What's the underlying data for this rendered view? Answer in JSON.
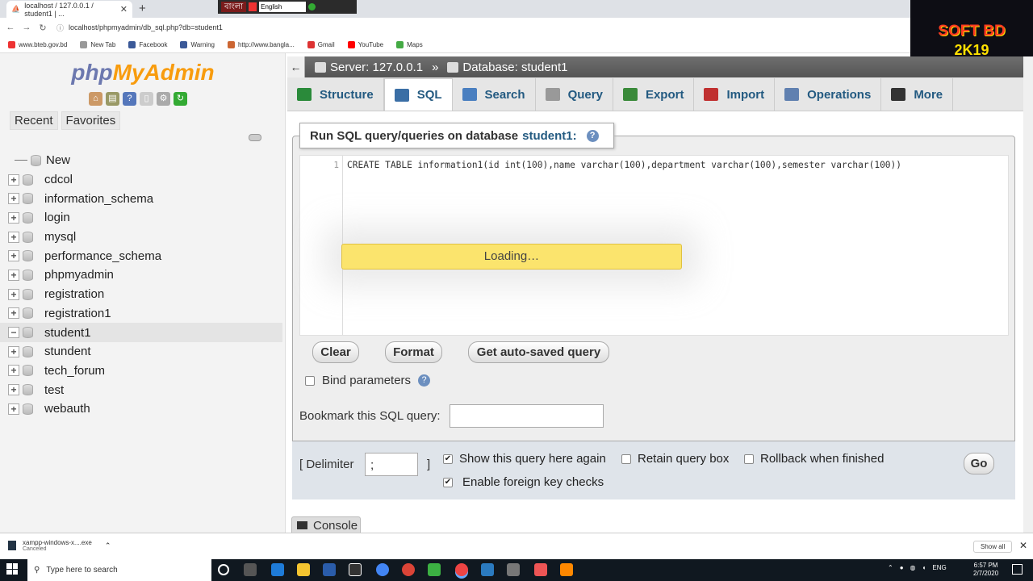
{
  "browser": {
    "tab_title": "localhost / 127.0.0.1 / student1 | ...",
    "tab_close": "✕",
    "new_tab": "+",
    "url": "localhost/phpmyadmin/db_sql.php?db=student1",
    "lang_bengali": "বাংলা",
    "lang_select": "English",
    "bookmarks": [
      "www.bteb.gov.bd",
      "New Tab",
      "Facebook",
      "Warning",
      "http://www.bangla...",
      "Gmail",
      "YouTube",
      "Maps"
    ]
  },
  "watermark": {
    "line1": "SOFT BD",
    "line2": "2K19"
  },
  "sidebar": {
    "logo_php": "php",
    "logo_admin": "MyAdmin",
    "recent": "Recent",
    "favorites": "Favorites",
    "new_label": "New",
    "databases": [
      "cdcol",
      "information_schema",
      "login",
      "mysql",
      "performance_schema",
      "phpmyadmin",
      "registration",
      "registration1",
      "student1",
      "stundent",
      "tech_forum",
      "test",
      "webauth"
    ],
    "selected_db": "student1"
  },
  "header": {
    "back": "←",
    "server": "Server: 127.0.0.1",
    "separator": "»",
    "database": "Database: student1"
  },
  "tabs": [
    {
      "label": "Structure",
      "color": "#2a8a3a"
    },
    {
      "label": "SQL",
      "color": "#3a6ea5"
    },
    {
      "label": "Search",
      "color": "#4a7fc0"
    },
    {
      "label": "Query",
      "color": "#999999"
    },
    {
      "label": "Export",
      "color": "#3a8a3a"
    },
    {
      "label": "Import",
      "color": "#c03030"
    },
    {
      "label": "Operations",
      "color": "#6080b0"
    },
    {
      "label": "More",
      "color": "#333333"
    }
  ],
  "sql_panel": {
    "legend_prefix": "Run SQL query/queries on database",
    "legend_db": "student1:",
    "line_number": "1",
    "query_text": "CREATE TABLE information1(id int(100),name varchar(100),department varchar(100),semester varchar(100))",
    "loading": "Loading…",
    "clear": "Clear",
    "format": "Format",
    "get_autosaved": "Get auto-saved query",
    "bind_parameters": "Bind parameters",
    "bookmark_label": "Bookmark this SQL query:",
    "bookmark_value": ""
  },
  "options": {
    "delimiter_label": "[ Delimiter",
    "delimiter_value": ";",
    "delimiter_close": "]",
    "show_query_again": "Show this query here again",
    "retain_query_box": "Retain query box",
    "rollback": "Rollback when finished",
    "foreign_key_checks": "Enable foreign key checks",
    "go": "Go",
    "checked": "✔"
  },
  "console": {
    "label": "Console"
  },
  "download": {
    "filename": "xampp-windows-x....exe",
    "status": "Canceled",
    "show_all": "Show all",
    "close": "✕"
  },
  "taskbar": {
    "search_placeholder": "Type here to search",
    "lang": "ENG",
    "time": "6:57 PM",
    "date": "2/7/2020"
  }
}
